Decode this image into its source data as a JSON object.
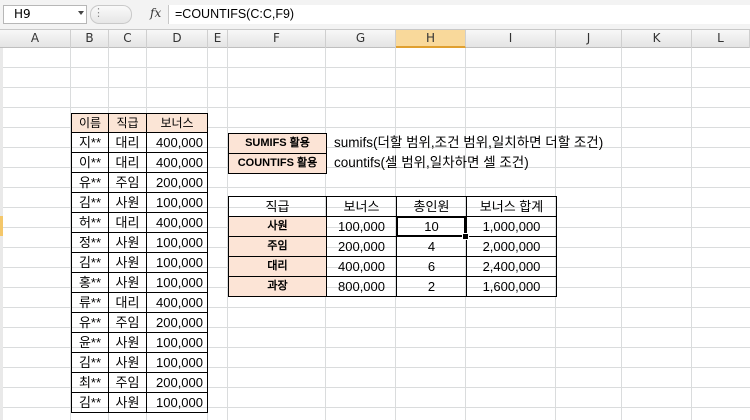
{
  "formula_bar": {
    "cell_ref": "H9",
    "fx": "fx",
    "formula": "=COUNTIFS(C:C,F9)"
  },
  "columns": [
    "A",
    "B",
    "C",
    "D",
    "E",
    "F",
    "G",
    "H",
    "I",
    "J",
    "K",
    "L"
  ],
  "active_column": "H",
  "employee_table": {
    "headers": [
      "이름",
      "직급",
      "보너스"
    ],
    "rows": [
      [
        "지**",
        "대리",
        "400,000"
      ],
      [
        "이**",
        "대리",
        "400,000"
      ],
      [
        "유**",
        "주임",
        "200,000"
      ],
      [
        "김**",
        "사원",
        "100,000"
      ],
      [
        "허**",
        "대리",
        "400,000"
      ],
      [
        "정**",
        "사원",
        "100,000"
      ],
      [
        "김**",
        "사원",
        "100,000"
      ],
      [
        "홍**",
        "사원",
        "100,000"
      ],
      [
        "류**",
        "대리",
        "400,000"
      ],
      [
        "유**",
        "주임",
        "200,000"
      ],
      [
        "윤**",
        "사원",
        "100,000"
      ],
      [
        "김**",
        "사원",
        "100,000"
      ],
      [
        "최**",
        "주임",
        "200,000"
      ],
      [
        "김**",
        "사원",
        "100,000"
      ]
    ]
  },
  "notes": [
    {
      "label": "SUMIFS 활용",
      "text": "sumifs(더할 범위,조건 범위,일치하면 더할 조건)"
    },
    {
      "label": "COUNTIFS 활용",
      "text": "countifs(셀 범위,일차하면 셀 조건)"
    }
  ],
  "summary_table": {
    "headers": [
      "직급",
      "보너스",
      "총인원",
      "보너스 합계"
    ],
    "rows": [
      [
        "사원",
        "100,000",
        "10",
        "1,000,000"
      ],
      [
        "주임",
        "200,000",
        "4",
        "2,000,000"
      ],
      [
        "대리",
        "400,000",
        "6",
        "2,400,000"
      ],
      [
        "과장",
        "800,000",
        "2",
        "1,600,000"
      ]
    ]
  }
}
